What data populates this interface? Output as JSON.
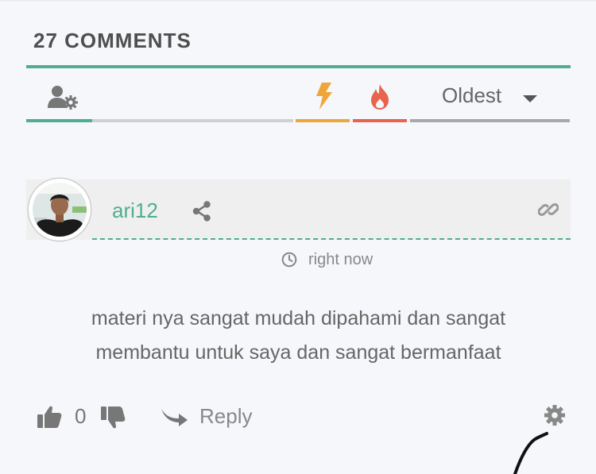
{
  "comments_header": {
    "count_label": "27 COMMENTS"
  },
  "toolbar": {
    "user_settings_icon": "user-cog-icon",
    "hottest_icon": "bolt-icon",
    "popular_icon": "fire-icon",
    "sort_label": "Oldest",
    "colors": {
      "active": "#4fae8d",
      "hottest": "#f0a538",
      "popular": "#e9634d"
    }
  },
  "comment": {
    "author": "ari12",
    "timestamp": "right now",
    "text_line1": "materi nya sangat mudah dipahami dan sangat",
    "text_line2": "membantu untuk saya dan sangat bermanfaat",
    "votes": "0",
    "reply_label": "Reply"
  }
}
